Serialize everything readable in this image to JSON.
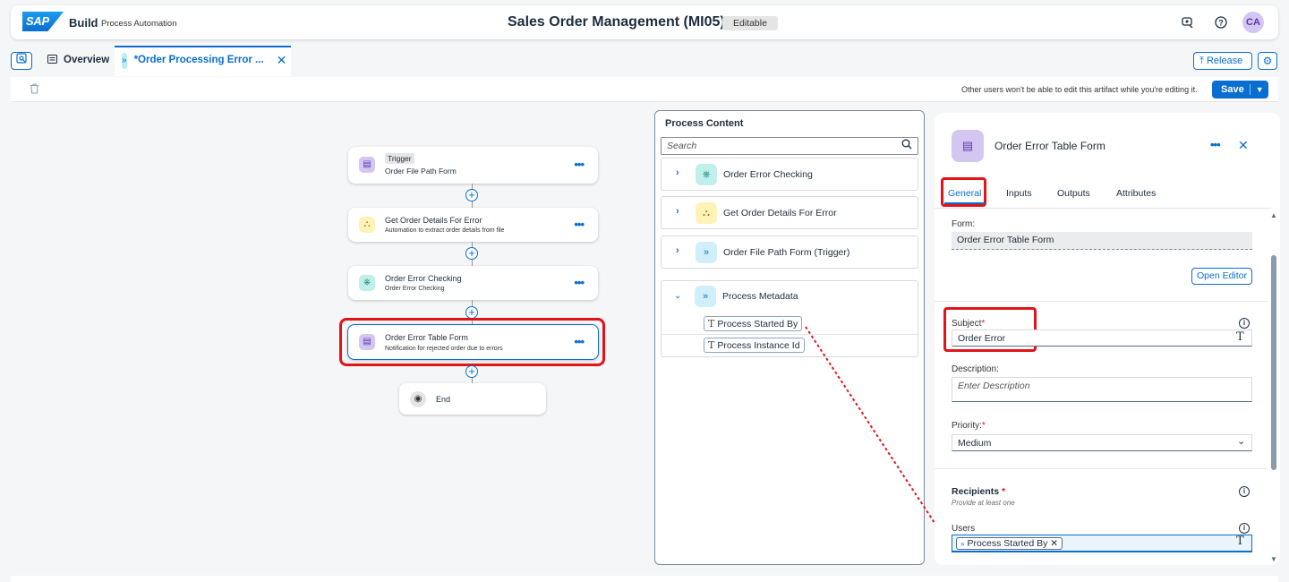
{
  "shell": {
    "logo": "SAP",
    "product": "Build",
    "product_sub": "Process Automation",
    "title": "Sales Order Management (MI05)",
    "badge": "Editable",
    "avatar": "CA"
  },
  "tabs": {
    "overview": "Overview",
    "active": "*Order Processing Error ..."
  },
  "actions": {
    "release": "Release",
    "save": "Save",
    "edit_note": "Other users won't be able to edit this artifact while you're editing it."
  },
  "canvas": {
    "trigger_tag": "Trigger",
    "trigger_title": "Order File Path Form",
    "steps": [
      {
        "title": "Get Order Details For Error",
        "subtitle": "Automation to extract order details from file"
      },
      {
        "title": "Order Error Checking",
        "subtitle": "Order Error Checking"
      },
      {
        "title": "Order Error Table Form",
        "subtitle": "Notification for rejected order due to errors"
      }
    ],
    "end": "End"
  },
  "process_content": {
    "title": "Process Content",
    "search_placeholder": "Search",
    "items": [
      "Order Error Checking",
      "Get Order Details For Error",
      "Order File Path Form (Trigger)"
    ],
    "metadata_group": "Process Metadata",
    "metadata_items": [
      "Process Started By",
      "Process Instance Id"
    ]
  },
  "properties": {
    "title": "Order Error Table Form",
    "tabs": [
      "General",
      "Inputs",
      "Outputs",
      "Attributes"
    ],
    "form_label": "Form:",
    "form_value": "Order Error Table Form",
    "open_editor": "Open Editor",
    "subject_label": "Subject",
    "subject_value": "Order Error",
    "description_label": "Description:",
    "description_placeholder": "Enter Description",
    "priority_label": "Priority:",
    "priority_value": "Medium",
    "recipients_label": "Recipients",
    "recipients_hint": "Provide at least one",
    "users_label": "Users",
    "users_chip": "Process Started By",
    "required_mark": "*"
  },
  "colors": {
    "accent": "#0a6ed1",
    "highlight": "#e3131a"
  }
}
